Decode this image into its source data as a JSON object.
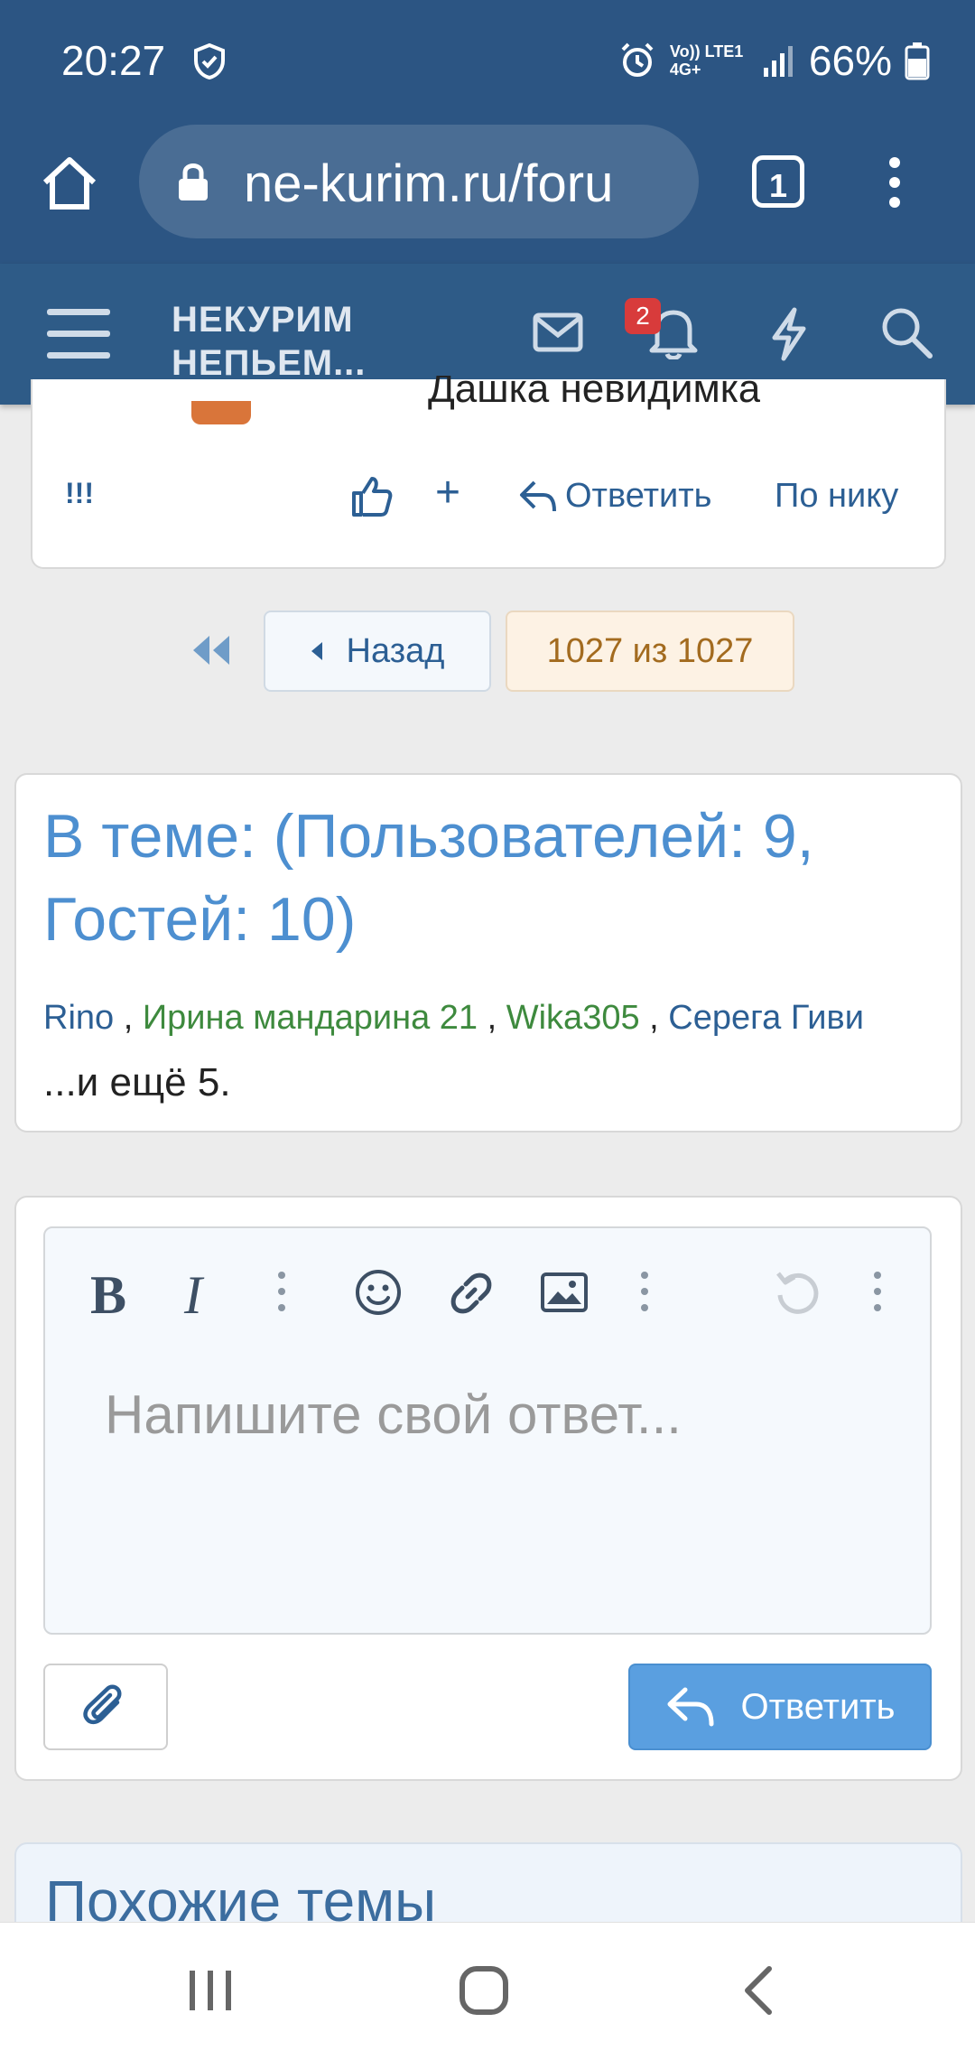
{
  "status": {
    "time": "20:27",
    "battery": "66%",
    "network": "Vo)) LTE1 4G+"
  },
  "browser": {
    "url": "ne-kurim.ru/foru",
    "tabs": "1"
  },
  "header": {
    "logo_line1": "НЕКУРИМ",
    "logo_line2": "НЕПЬЕМ...",
    "notif_count": "2"
  },
  "post": {
    "author": "Дашка невидимка",
    "flag": "!!!",
    "plus": "+",
    "reply": "Ответить",
    "by_nick": "По нику"
  },
  "pagination": {
    "back": "Назад",
    "current": "1027 из 1027"
  },
  "online": {
    "title": "В теме: (Пользователей: 9, Гостей: 10)",
    "users": [
      {
        "name": "Rino",
        "color": "#2c5f94"
      },
      {
        "name": "Ирина мандарина 21",
        "color": "#3e8a3e"
      },
      {
        "name": "Wika305",
        "color": "#3e8a3e"
      },
      {
        "name": "Серега Гиви",
        "color": "#2c5f94"
      }
    ],
    "more": "...и ещё 5."
  },
  "editor": {
    "placeholder": "Напишите свой ответ...",
    "submit": "Ответить"
  },
  "similar": {
    "title": "Похожие темы"
  },
  "colors": {
    "primary": "#2e5b87",
    "accent": "#5a9fe0",
    "link": "#2c5f94",
    "green": "#3e8a3e"
  }
}
